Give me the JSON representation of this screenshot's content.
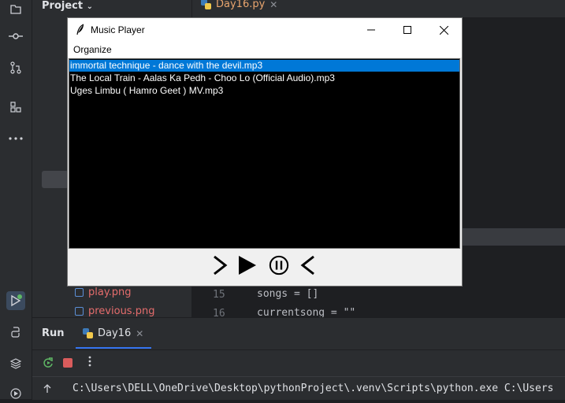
{
  "ide": {
    "project_header": "Project",
    "editor_tab": "Day16.py",
    "files": [
      {
        "name": "play.png"
      },
      {
        "name": "previous.png"
      }
    ],
    "code_lines": [
      {
        "no": "15",
        "code": "songs = []"
      },
      {
        "no": "16",
        "code": "currentsong = \"\""
      }
    ],
    "run_panel": {
      "title": "Run",
      "tab": "Day16",
      "console": "C:\\Users\\DELL\\OneDrive\\Desktop\\pythonProject\\.venv\\Scripts\\python.exe C:\\Users"
    },
    "icons": [
      "commit-icon",
      "pull-request-icon",
      "structure-icon",
      "more-icon",
      "run-icon",
      "python-console-icon",
      "layers-icon",
      "services-icon"
    ]
  },
  "player": {
    "title": "Music Player",
    "menu": [
      "Organize"
    ],
    "songs": [
      "immortal technique - dance with the devil.mp3",
      "The Local Train - Aalas Ka Pedh - Choo Lo (Official Audio).mp3",
      "Uges Limbu ( Hamro Geet ) MV.mp3"
    ],
    "selected_index": 0,
    "controls": [
      "next-icon",
      "play-icon",
      "pause-icon",
      "previous-icon"
    ],
    "colors": {
      "selection": "#0078d7",
      "list_bg": "#000000"
    }
  }
}
